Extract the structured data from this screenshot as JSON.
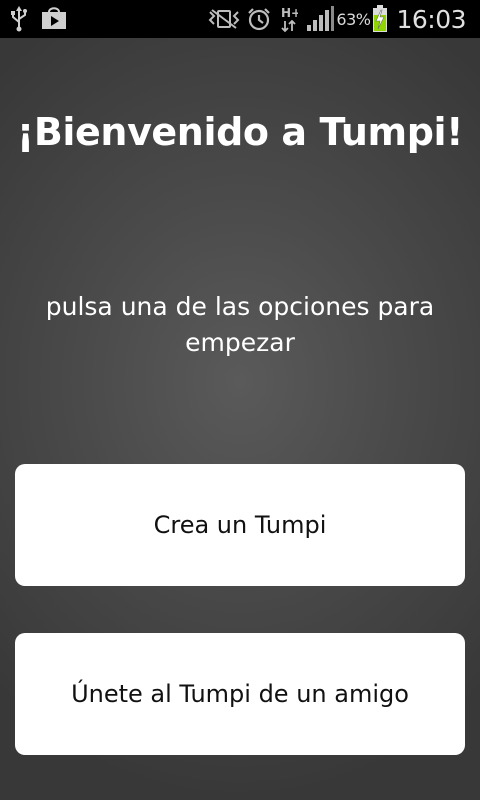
{
  "status_bar": {
    "left_icons": [
      "usb-icon",
      "play-store-icon"
    ],
    "right_icons": [
      "vibrate-icon",
      "alarm-icon",
      "hplus-data-icon",
      "signal-icon",
      "battery-charging-icon"
    ],
    "data_label": "H+",
    "battery_percent": "63%",
    "time": "16:03",
    "battery_color": "#8fd400"
  },
  "main": {
    "title": "¡Bienvenido a Tumpi!",
    "subtitle": "pulsa una de las opciones para empezar",
    "buttons": [
      {
        "label": "Crea un Tumpi"
      },
      {
        "label": "Únete al Tumpi de un amigo"
      }
    ]
  },
  "colors": {
    "background": "#4a4a4a",
    "button_bg": "#ffffff",
    "button_text": "#111111",
    "text": "#ffffff"
  }
}
